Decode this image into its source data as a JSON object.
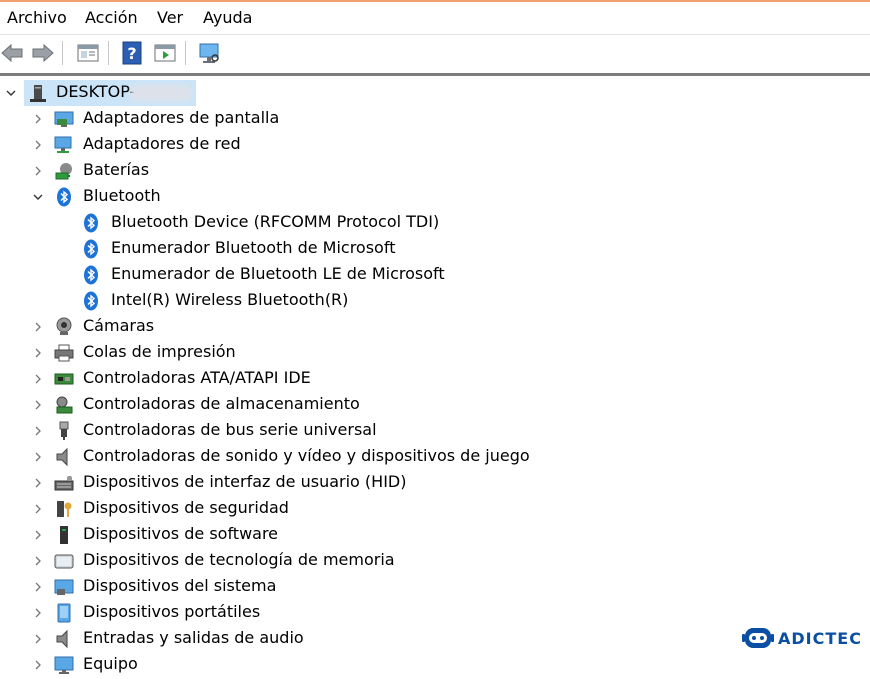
{
  "menu": {
    "items": [
      "Archivo",
      "Acción",
      "Ver",
      "Ayuda"
    ]
  },
  "toolbar": {
    "buttons": [
      "back-arrow-icon",
      "forward-arrow-icon",
      "properties-icon",
      "help-icon",
      "update-driver-icon",
      "scan-hardware-icon"
    ]
  },
  "tree": {
    "root": {
      "label": "DESKTOP-",
      "icon": "computer-tower-icon",
      "expanded": true
    },
    "items": [
      {
        "label": "Adaptadores de pantalla",
        "icon": "display-adapter-icon",
        "level": 1,
        "expanded": false
      },
      {
        "label": "Adaptadores de red",
        "icon": "network-adapter-icon",
        "level": 1,
        "expanded": false
      },
      {
        "label": "Baterías",
        "icon": "battery-icon",
        "level": 1,
        "expanded": false
      },
      {
        "label": "Bluetooth",
        "icon": "bluetooth-icon",
        "level": 1,
        "expanded": true
      },
      {
        "label": "Bluetooth Device (RFCOMM Protocol TDI)",
        "icon": "bluetooth-icon",
        "level": 2
      },
      {
        "label": "Enumerador Bluetooth de Microsoft",
        "icon": "bluetooth-icon",
        "level": 2
      },
      {
        "label": "Enumerador de Bluetooth LE de Microsoft",
        "icon": "bluetooth-icon",
        "level": 2
      },
      {
        "label": "Intel(R) Wireless Bluetooth(R)",
        "icon": "bluetooth-icon",
        "level": 2
      },
      {
        "label": "Cámaras",
        "icon": "webcam-icon",
        "level": 1,
        "expanded": false
      },
      {
        "label": "Colas de impresión",
        "icon": "printer-icon",
        "level": 1,
        "expanded": false
      },
      {
        "label": "Controladoras ATA/ATAPI IDE",
        "icon": "ide-controller-icon",
        "level": 1,
        "expanded": false
      },
      {
        "label": "Controladoras de almacenamiento",
        "icon": "storage-controller-icon",
        "level": 1,
        "expanded": false
      },
      {
        "label": "Controladoras de bus serie universal",
        "icon": "usb-icon",
        "level": 1,
        "expanded": false
      },
      {
        "label": "Controladoras de sonido y vídeo y dispositivos de juego",
        "icon": "speaker-icon",
        "level": 1,
        "expanded": false
      },
      {
        "label": "Dispositivos de interfaz de usuario (HID)",
        "icon": "hid-keyboard-icon",
        "level": 1,
        "expanded": false
      },
      {
        "label": "Dispositivos de seguridad",
        "icon": "security-key-icon",
        "level": 1,
        "expanded": false
      },
      {
        "label": "Dispositivos de software",
        "icon": "software-device-icon",
        "level": 1,
        "expanded": false
      },
      {
        "label": "Dispositivos de tecnología de memoria",
        "icon": "memory-card-icon",
        "level": 1,
        "expanded": false
      },
      {
        "label": "Dispositivos del sistema",
        "icon": "system-device-icon",
        "level": 1,
        "expanded": false
      },
      {
        "label": "Dispositivos portátiles",
        "icon": "portable-device-icon",
        "level": 1,
        "expanded": false
      },
      {
        "label": "Entradas y salidas de audio",
        "icon": "audio-io-icon",
        "level": 1,
        "expanded": false
      },
      {
        "label": "Equipo",
        "icon": "monitor-icon",
        "level": 1,
        "expanded": false
      }
    ]
  },
  "watermark": {
    "text": "ADICTEC",
    "icon": "robot-head-icon"
  },
  "colors": {
    "bluetooth_blue": "#1e73d8",
    "selection": "#cce4f7",
    "brand": "#0a4fa3"
  }
}
